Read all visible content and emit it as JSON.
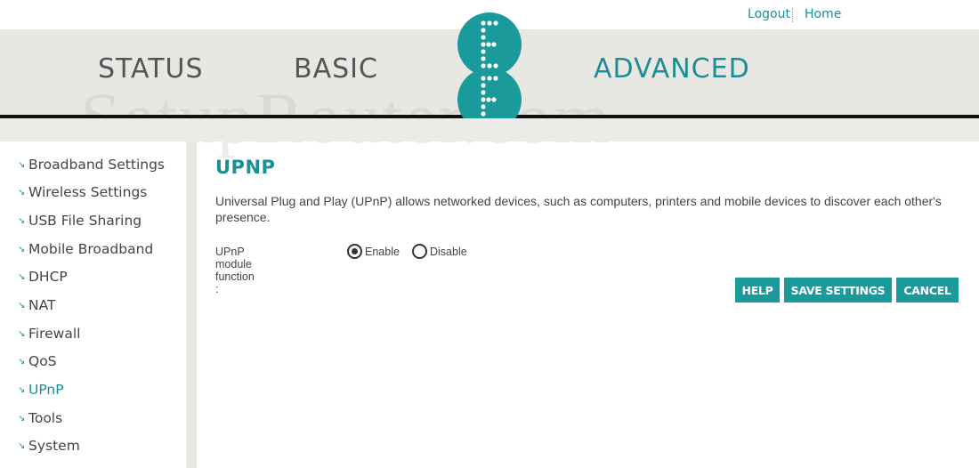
{
  "top_links": {
    "logout": "Logout",
    "home": "Home"
  },
  "nav": {
    "status": "STATUS",
    "basic": "BASIC",
    "advanced": "ADVANCED",
    "active": "ADVANCED"
  },
  "watermark": "SetupRouter.com",
  "sidebar": {
    "items": [
      {
        "label": "Broadband Settings"
      },
      {
        "label": "Wireless Settings"
      },
      {
        "label": "USB File Sharing"
      },
      {
        "label": "Mobile Broadband"
      },
      {
        "label": "DHCP"
      },
      {
        "label": "NAT"
      },
      {
        "label": "Firewall"
      },
      {
        "label": "QoS"
      },
      {
        "label": "UPnP",
        "active": true
      },
      {
        "label": "Tools"
      },
      {
        "label": "System"
      }
    ]
  },
  "main": {
    "title": "UPNP",
    "description": "Universal Plug and Play (UPnP) allows networked devices, such as computers, printers and mobile devices to discover each other's presence.",
    "upnp_field": {
      "label": "UPnP module function :",
      "options": [
        "Enable",
        "Disable"
      ],
      "selected": "Enable"
    },
    "buttons": {
      "help": "HELP",
      "save": "SAVE SETTINGS",
      "cancel": "CANCEL"
    }
  },
  "colors": {
    "accent": "#1b8f93",
    "button": "#1b9a9c",
    "header_band": "#e9e7e4",
    "text": "#444444"
  },
  "icons": {
    "logo": "ee-logo",
    "sidebar_bullet": "arrow-down-right-icon"
  }
}
